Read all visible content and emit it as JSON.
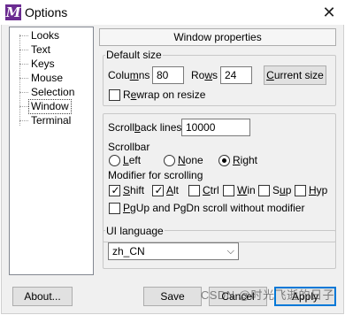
{
  "window": {
    "title": "Options",
    "close_glyph": "✕"
  },
  "tree": {
    "items": [
      {
        "label": "Looks",
        "selected": false
      },
      {
        "label": "Text",
        "selected": false
      },
      {
        "label": "Keys",
        "selected": false
      },
      {
        "label": "Mouse",
        "selected": false
      },
      {
        "label": "Selection",
        "selected": false
      },
      {
        "label": "Window",
        "selected": true
      },
      {
        "label": "Terminal",
        "selected": false
      }
    ]
  },
  "header": {
    "label": "Window properties"
  },
  "default_size": {
    "title": "Default size",
    "columns_label": "Columns",
    "columns_value": "80",
    "rows_label": "Rows",
    "rows_value": "24",
    "current_size_button": "Current size",
    "rewrap_label": "Rewrap on resize",
    "rewrap_checked": false
  },
  "scroll": {
    "scrollback_label": "Scrollback lines",
    "scrollback_value": "10000",
    "scrollbar_label": "Scrollbar",
    "options": [
      {
        "label": "Left",
        "selected": false
      },
      {
        "label": "None",
        "selected": false
      },
      {
        "label": "Right",
        "selected": true
      }
    ],
    "modifier_label": "Modifier for scrolling",
    "modifiers": [
      {
        "label": "Shift",
        "checked": true
      },
      {
        "label": "Alt",
        "checked": true
      },
      {
        "label": "Ctrl",
        "checked": false
      },
      {
        "label": "Win",
        "checked": false
      },
      {
        "label": "Sup",
        "checked": false
      },
      {
        "label": "Hyp",
        "checked": false
      }
    ],
    "pgup_label": "PgUp and PgDn scroll without modifier",
    "pgup_checked": false
  },
  "ui_language": {
    "title": "UI language",
    "value": "zh_CN"
  },
  "footer": {
    "about": "About...",
    "save": "Save",
    "cancel": "Cancel",
    "apply": "Apply"
  },
  "watermark": "CSDN @时光飞逝的日子",
  "colors": {
    "app_icon": "#6b2c91",
    "focus_border": "#0078d7"
  }
}
